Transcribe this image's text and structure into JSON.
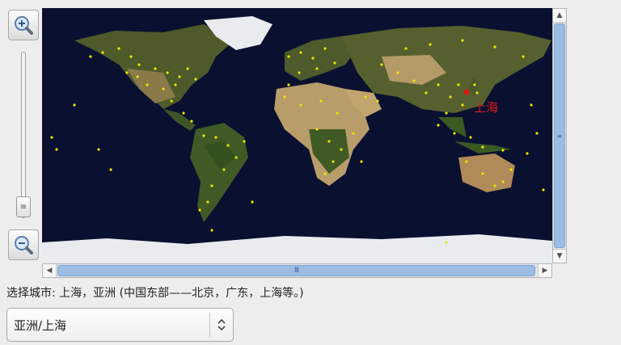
{
  "map": {
    "selected_city_label": "上海",
    "colors": {
      "ocean": "#0a1030",
      "land": "#4e5a2a",
      "desert": "#b89c6a",
      "ice": "#e8ecef",
      "city_dot": "#e8e800",
      "selected": "#e01818"
    }
  },
  "zoom": {
    "zoom_in_icon": "zoom-in-magnifier-icon",
    "zoom_out_icon": "zoom-out-magnifier-icon"
  },
  "scrollbars": {
    "horizontal_grip": "III",
    "vertical_grip": "≡",
    "slider_grip": "≡"
  },
  "caption": "选择城市: 上海，亚洲 (中国东部——北京，广东，上海等。)",
  "timezone_select": {
    "value": "亚洲/上海"
  }
}
